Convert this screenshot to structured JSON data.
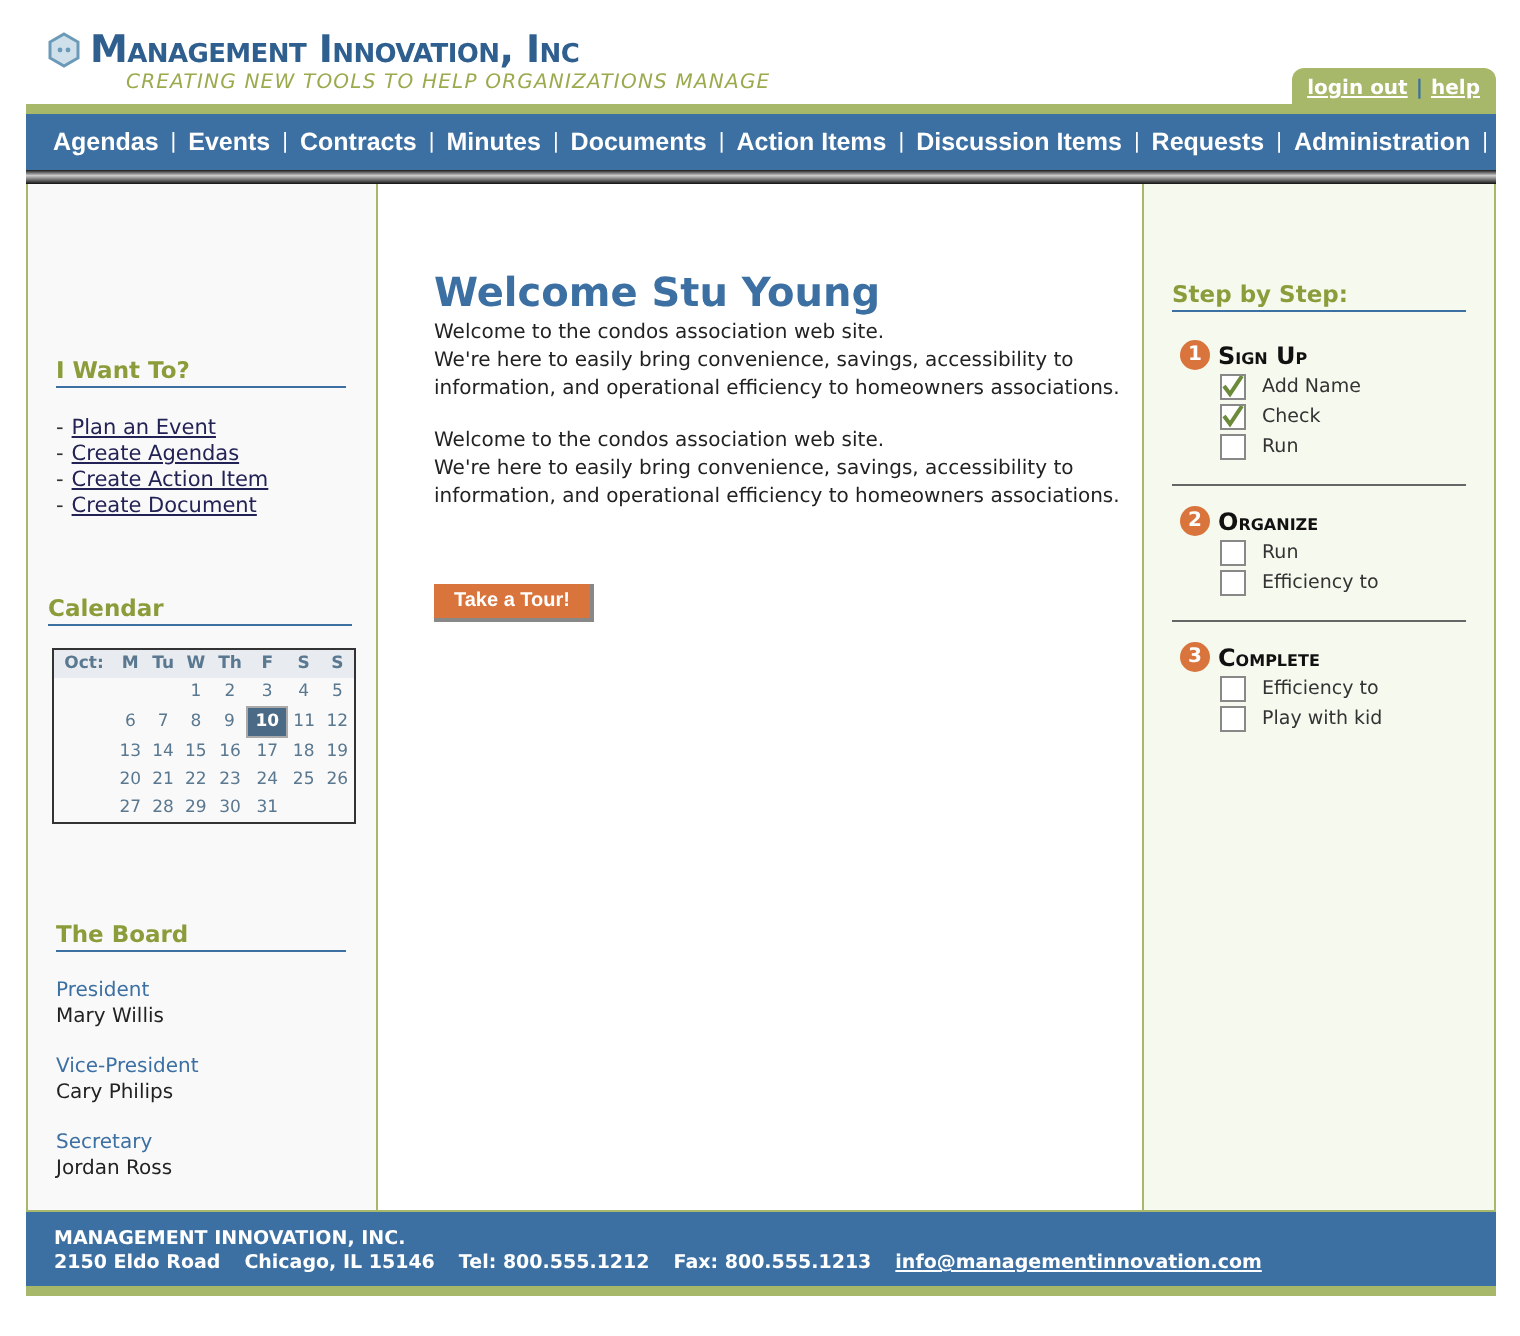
{
  "header": {
    "company": "Management Innovation, Inc",
    "tagline": "CREATING NEW TOOLS TO HELP ORGANIZATIONS MANAGE",
    "links": [
      {
        "label": "login out"
      },
      {
        "label": "help"
      }
    ],
    "link_separator": "|"
  },
  "nav": {
    "items": [
      "Agendas",
      "Events",
      "Contracts",
      "Minutes",
      "Documents",
      "Action Items",
      "Discussion Items",
      "Requests",
      "Administration"
    ],
    "separator": "|"
  },
  "sidebar": {
    "want_title": "I Want To?",
    "want_links": [
      {
        "bullet": "-",
        "label": "Plan an Event"
      },
      {
        "bullet": "-",
        "label": "Create Agendas"
      },
      {
        "bullet": "-",
        "label": "Create Action Item"
      },
      {
        "bullet": "-",
        "label": "Create Document"
      }
    ],
    "calendar_title": "Calendar",
    "calendar": {
      "month": "Oct:",
      "weekdays": [
        "M",
        "Tu",
        "W",
        "Th",
        "F",
        "S",
        "S"
      ],
      "weeks": [
        [
          {
            "day": "1",
            "selected": false
          },
          {
            "day": "2",
            "selected": false
          },
          {
            "day": "3",
            "selected": false
          },
          {
            "day": "4",
            "selected": false
          },
          {
            "day": "5",
            "selected": false
          }
        ],
        [
          {
            "day": "6",
            "selected": false
          },
          {
            "day": "7",
            "selected": false
          },
          {
            "day": "8",
            "selected": false
          },
          {
            "day": "9",
            "selected": false
          },
          {
            "day": "10",
            "selected": true
          },
          {
            "day": "11",
            "selected": false
          },
          {
            "day": "12",
            "selected": false
          }
        ],
        [
          {
            "day": "13",
            "selected": false
          },
          {
            "day": "14",
            "selected": false
          },
          {
            "day": "15",
            "selected": false
          },
          {
            "day": "16",
            "selected": false
          },
          {
            "day": "17",
            "selected": false
          },
          {
            "day": "18",
            "selected": false
          },
          {
            "day": "19",
            "selected": false
          }
        ],
        [
          {
            "day": "20",
            "selected": false
          },
          {
            "day": "21",
            "selected": false
          },
          {
            "day": "22",
            "selected": false
          },
          {
            "day": "23",
            "selected": false
          },
          {
            "day": "24",
            "selected": false
          },
          {
            "day": "25",
            "selected": false
          },
          {
            "day": "26",
            "selected": false
          }
        ],
        [
          {
            "day": "27",
            "selected": false
          },
          {
            "day": "28",
            "selected": false
          },
          {
            "day": "29",
            "selected": false
          },
          {
            "day": "30",
            "selected": false
          },
          {
            "day": "31",
            "selected": false
          }
        ]
      ]
    },
    "board_title": "The Board",
    "board": [
      {
        "role": "President",
        "name": "Mary Willis"
      },
      {
        "role": "Vice-President",
        "name": "Cary Philips"
      },
      {
        "role": "Secretary",
        "name": "Jordan Ross"
      }
    ]
  },
  "main": {
    "title": "Welcome Stu Young",
    "paragraphs": [
      {
        "lines": [
          "Welcome to the condos association web site.",
          "We're here to easily bring convenience, savings, accessibility to information, and operational efficiency to homeowners associations."
        ]
      },
      {
        "lines": [
          "Welcome to the condos association web site.",
          "We're here to easily bring convenience, savings, accessibility to information, and operational efficiency to homeowners associations."
        ]
      }
    ],
    "tour_button": "Take a Tour!"
  },
  "steps": {
    "title": "Step by Step:",
    "sections": [
      {
        "number": "1",
        "title": "Sign Up",
        "tasks": [
          {
            "label": "Add Name",
            "checked": true
          },
          {
            "label": "Check",
            "checked": true
          },
          {
            "label": "Run",
            "checked": false
          }
        ]
      },
      {
        "number": "2",
        "title": "Organize",
        "tasks": [
          {
            "label": "Run",
            "checked": false
          },
          {
            "label": "Efficiency to",
            "checked": false
          }
        ]
      },
      {
        "number": "3",
        "title": "Complete",
        "tasks": [
          {
            "label": "Efficiency to",
            "checked": false
          },
          {
            "label": "Play with kid",
            "checked": false
          }
        ]
      }
    ]
  },
  "footer": {
    "company": "MANAGEMENT INNOVATION, INC.",
    "address": "2150 Eldo Road",
    "city": "Chicago, IL 15146",
    "tel": "Tel: 800.555.1212",
    "fax": "Fax: 800.555.1213",
    "email": "info@managementinnovation.com"
  }
}
